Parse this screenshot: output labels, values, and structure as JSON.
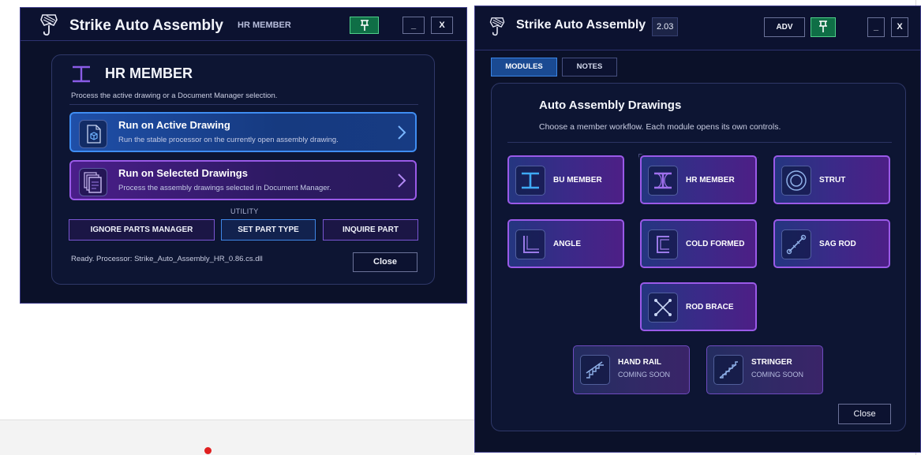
{
  "left_window": {
    "title": "Strike Auto Assembly",
    "subtitle": "HR MEMBER",
    "min_label": "_",
    "close_label": "X",
    "panel": {
      "heading": "HR MEMBER",
      "description": "Process the active drawing or a Document Manager selection.",
      "run_active": {
        "title": "Run on Active Drawing",
        "subtitle": "Run the stable processor on the currently open assembly drawing."
      },
      "run_selected": {
        "title": "Run on Selected Drawings",
        "subtitle": "Process the assembly drawings selected in Document Manager."
      },
      "utility_label": "UTILITY",
      "ignore_parts_label": "IGNORE PARTS MANAGER",
      "set_part_type_label": "SET PART TYPE",
      "inquire_part_label": "INQUIRE PART",
      "status": "Ready. Processor: Strike_Auto_Assembly_HR_0.86.cs.dll",
      "close_button": "Close"
    }
  },
  "right_window": {
    "title": "Strike Auto Assembly",
    "version": "2.03",
    "adv_label": "ADV",
    "min_label": "_",
    "close_label": "X",
    "tabs": [
      {
        "label": "MODULES",
        "active": true
      },
      {
        "label": "NOTES",
        "active": false
      }
    ],
    "section_title": "Auto Assembly Drawings",
    "section_desc": "Choose a member workflow. Each module opens its own controls.",
    "modules": [
      {
        "label": "BU MEMBER",
        "icon": "i-beam-icon"
      },
      {
        "label": "HR MEMBER",
        "icon": "i-beam-icon"
      },
      {
        "label": "STRUT",
        "icon": "circle-target-icon"
      },
      {
        "label": "ANGLE",
        "icon": "angle-icon"
      },
      {
        "label": "COLD FORMED",
        "icon": "channel-icon"
      },
      {
        "label": "SAG ROD",
        "icon": "rod-icon"
      },
      {
        "label": "ROD BRACE",
        "icon": "x-brace-icon"
      },
      {
        "label": "HAND RAIL",
        "sub": "COMING SOON",
        "icon": "stair-rail-icon"
      },
      {
        "label": "STRINGER",
        "sub": "COMING SOON",
        "icon": "stair-icon"
      }
    ],
    "close_button": "Close"
  },
  "colors": {
    "window_bg": "#0b1129",
    "accent_purple": "#9a5ae8",
    "accent_blue": "#3f8df2",
    "pin_green": "#0f6e46"
  }
}
